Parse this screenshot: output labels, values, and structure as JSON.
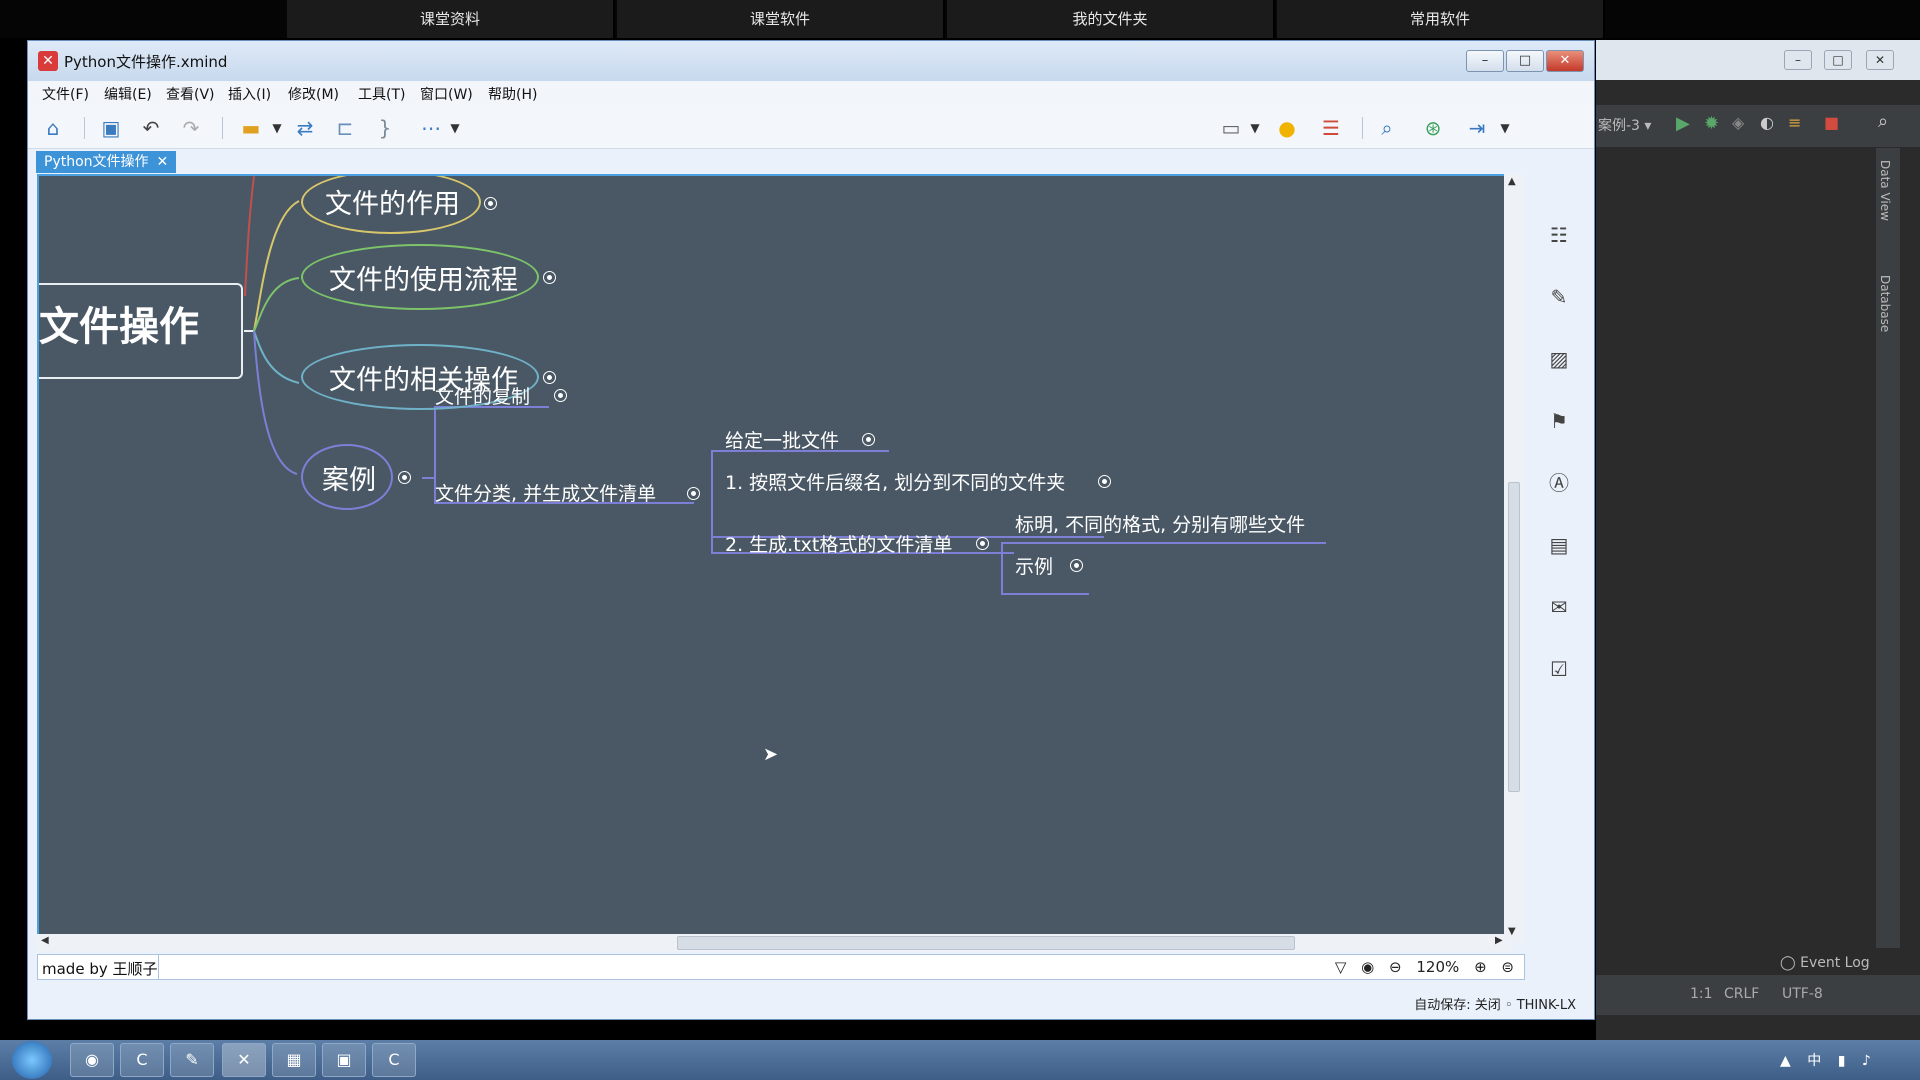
{
  "top_tabs": [
    "课堂资料",
    "课堂软件",
    "我的文件夹",
    "常用软件"
  ],
  "ide": {
    "run_config": "案例-3",
    "right_tools": [
      "Data View",
      "Database"
    ],
    "event_log": "Event Log",
    "status": {
      "position": "1:1",
      "line_sep": "CRLF",
      "encoding": "UTF-8"
    }
  },
  "window": {
    "title": "Python文件操作.xmind",
    "menu": [
      "文件(F)",
      "编辑(E)",
      "查看(V)",
      "插入(I)",
      "修改(M)",
      "工具(T)",
      "窗口(W)",
      "帮助(H)"
    ],
    "doc_tab": "Python文件操作",
    "close_glyph": "✕"
  },
  "mindmap": {
    "central": "文件操作",
    "topics": {
      "t1": "文件的作用",
      "t2": "文件的使用流程",
      "t3": "文件的相关操作",
      "t4": "案例"
    },
    "case": {
      "copy": "文件的复制",
      "classify": "文件分类, 并生成文件清单",
      "given": "给定一批文件",
      "step1": "1. 按照文件后缀名, 划分到不同的文件夹",
      "step2": "2. 生成.txt格式的文件清单",
      "step2a": "标明, 不同的格式, 分别有哪些文件",
      "step2b": "示例"
    },
    "colors": {
      "t1": "#d8c76a",
      "t2": "#7cc36a",
      "t3": "#6fb2c8",
      "t4": "#7d7fd6"
    }
  },
  "status": {
    "credit": "made by 王顺子",
    "zoom": "120%",
    "autosave": "自动保存: 关闭",
    "machine": "THINK-LX"
  }
}
